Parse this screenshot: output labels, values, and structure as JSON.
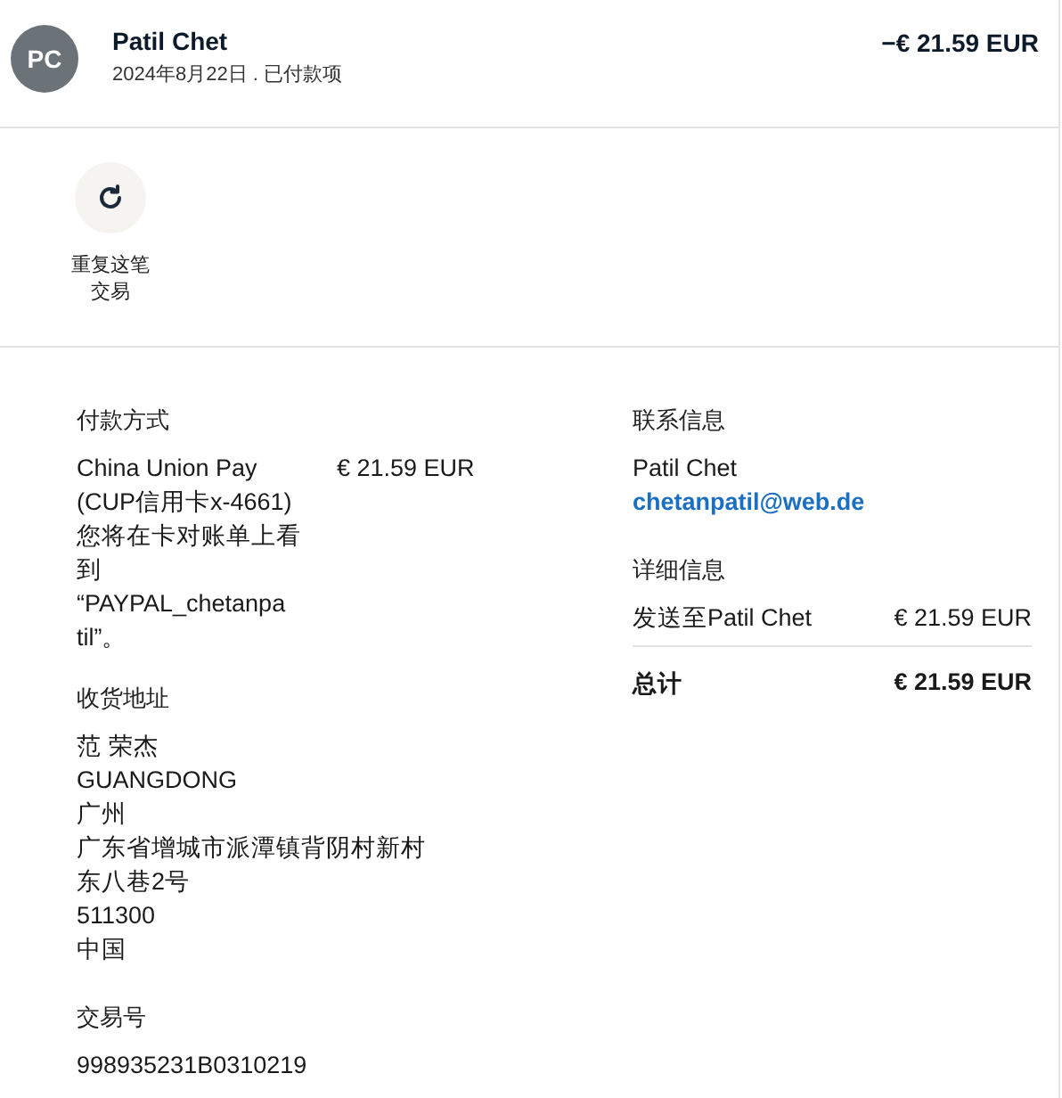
{
  "header": {
    "avatar": "PC",
    "name": "Patil Chet",
    "subtitle": "2024年8月22日 . 已付款项",
    "amount": "−€ 21.59 EUR"
  },
  "actions": [
    {
      "kind": "repeat",
      "label_lines": [
        "重复这笔",
        "交易"
      ]
    }
  ],
  "payment": {
    "heading": "付款方式",
    "lines": [
      "China Union Pay",
      "(CUP信用卡x-4661)",
      "您将在卡对账单上看",
      "到",
      "“PAYPAL_chetanpa",
      "til”。"
    ],
    "amount": "€ 21.59 EUR"
  },
  "shipping": {
    "heading": "收货地址",
    "lines": [
      "范 荣杰",
      "GUANGDONG",
      "广州",
      "广东省增城市派潭镇背阴村新村",
      "东八巷2号",
      "511300",
      "中国"
    ]
  },
  "transaction": {
    "heading": "交易号",
    "id": "998935231B0310219"
  },
  "contact": {
    "heading": "联系信息",
    "name": "Patil Chet",
    "email": "chetanpatil@web.de"
  },
  "details": {
    "heading": "详细信息",
    "rows": [
      {
        "label": "发送至Patil Chet",
        "amount": "€ 21.59 EUR"
      }
    ],
    "total_label": "总计",
    "total_amount": "€ 21.59 EUR"
  }
}
